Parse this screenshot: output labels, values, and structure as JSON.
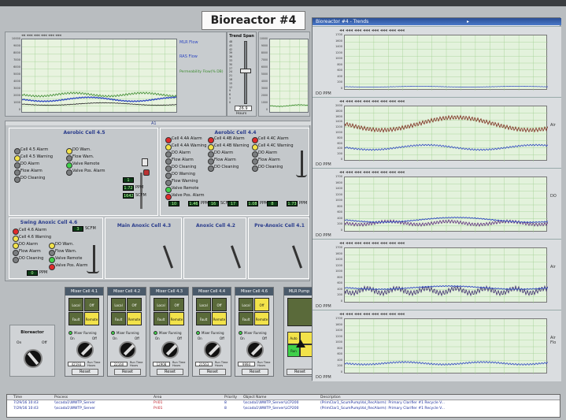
{
  "title": "Bioreactor #4",
  "top_chart": {
    "y_ticks": [
      "10000",
      "9000",
      "8000",
      "7000",
      "6000",
      "5000",
      "4000",
      "3000",
      "2000",
      "1000",
      "0"
    ],
    "legend": [
      {
        "label": "MLR Flow",
        "color": "#2e47c2"
      },
      {
        "label": "RAS Flow",
        "color": "#2e47c2"
      },
      {
        "label": "Permeability Flow(% DB)",
        "color": "#3a8a2c"
      }
    ]
  },
  "trend_span": {
    "label": "Trend Span",
    "ticks": [
      "48",
      "45",
      "42",
      "39",
      "36",
      "33",
      "30",
      "27",
      "24",
      "21",
      "18",
      "15",
      "12",
      "9",
      "6",
      "3",
      "0"
    ],
    "value": "26.9",
    "unit": "Hours"
  },
  "trends_window": {
    "title": "Bioreactor #4 - Trends",
    "rows": [
      {
        "y_ticks": [
          "1700",
          "1600",
          "1400",
          "1200",
          "1000",
          "800",
          "600",
          "400",
          "200",
          "0"
        ],
        "footer": "DO PPM",
        "side": ""
      },
      {
        "y_ticks": [
          "2000",
          "1800",
          "1600",
          "1400",
          "1200",
          "1000",
          "800",
          "600",
          "400",
          "200",
          "0"
        ],
        "footer": "DO PPM",
        "side": "Air"
      },
      {
        "y_ticks": [
          "1700",
          "1600",
          "1400",
          "1200",
          "1000",
          "800",
          "600",
          "400",
          "200",
          "0"
        ],
        "footer": "DO PPM",
        "side": "DO"
      },
      {
        "y_ticks": [
          "1700",
          "1600",
          "1400",
          "1200",
          "1000",
          "800",
          "600",
          "400",
          "200",
          "0"
        ],
        "footer": "DO PPM",
        "side": "Air"
      },
      {
        "y_ticks": [
          "1700",
          "1600",
          "1400",
          "1200",
          "1000",
          "800",
          "600",
          "400",
          "200",
          "0"
        ],
        "footer": "DO PPM",
        "side": "Air Flo"
      }
    ]
  },
  "cell45": {
    "label": "Aerobic Cell 4.5",
    "alarms": [
      {
        "text": "Cell 4.5 Alarm",
        "color": "#7b7e80"
      },
      {
        "text": "Cell 4.5 Warning",
        "color": "#f2e24a"
      },
      {
        "text": "DO Alarm",
        "color": "#7b7e80"
      },
      {
        "text": "Flow Alarm",
        "color": "#7b7e80"
      },
      {
        "text": "DO Cleaning",
        "color": "#7b7e80"
      },
      {
        "text": "DO Warn.",
        "color": "#f2e24a"
      },
      {
        "text": "Flow Warn.",
        "color": "#7b7e80"
      },
      {
        "text": "Valve Remote",
        "color": "#3fd04a"
      },
      {
        "text": "Valve Pos. Alarm",
        "color": "#7b7e80"
      }
    ],
    "values": [
      {
        "v": "1",
        "u": ""
      },
      {
        "v": "1.72",
        "u": "PPM"
      },
      {
        "v": "1642",
        "u": "SCFM"
      }
    ]
  },
  "cell44": {
    "label": "Aerobic Cell 4.4",
    "alarms": [
      {
        "text": "Cell 4.4A Alarm",
        "color": "#e02a2a"
      },
      {
        "text": "Cell 4.4A Warning",
        "color": "#f2e24a"
      },
      {
        "text": "DO Alarm",
        "color": "#7b7e80"
      },
      {
        "text": "Flow Alarm",
        "color": "#7b7e80"
      },
      {
        "text": "DO Cleaning",
        "color": "#7b7e80"
      },
      {
        "text": "DO Warning",
        "color": "#7b7e80"
      },
      {
        "text": "Flow Warning",
        "color": "#7b7e80"
      },
      {
        "text": "Valve Remote",
        "color": "#3fd04a"
      },
      {
        "text": "Valve Pos. Alarm",
        "color": "#e02a2a"
      },
      {
        "text": "Cell 4.4B Alarm",
        "color": "#e02a2a"
      },
      {
        "text": "Cell 4.4B Warning",
        "color": "#f2e24a"
      },
      {
        "text": "DO Alarm",
        "color": "#7b7e80"
      },
      {
        "text": "Flow Alarm",
        "color": "#7b7e80"
      },
      {
        "text": "DO Cleaning",
        "color": "#7b7e80"
      },
      {
        "text": "Cell 4.4C Alarm",
        "color": "#e02a2a"
      },
      {
        "text": "Cell 4.4C Warning",
        "color": "#f2e24a"
      },
      {
        "text": "DO Alarm",
        "color": "#7b7e80"
      },
      {
        "text": "Flow Alarm",
        "color": "#7b7e80"
      },
      {
        "text": "DO Cleaning",
        "color": "#7b7e80"
      }
    ],
    "values": [
      {
        "v": "10",
        "u": ""
      },
      {
        "v": "1.46",
        "u": "PPM"
      },
      {
        "v": "16",
        "u": "SCFM"
      },
      {
        "v": "17",
        "u": ""
      },
      {
        "v": "1.08",
        "u": "PPM"
      },
      {
        "v": "8",
        "u": ""
      },
      {
        "v": "1.73",
        "u": "PPM"
      }
    ]
  },
  "swing": {
    "label": "Swing Anoxic Cell 4.6",
    "alarms": [
      {
        "text": "Cell 4.6 Alarm",
        "color": "#e02a2a"
      },
      {
        "text": "Cell 4.6 Warning",
        "color": "#f2e24a"
      },
      {
        "text": "DO Alarm",
        "color": "#f2e24a"
      },
      {
        "text": "Flow Alarm",
        "color": "#7b7e80"
      },
      {
        "text": "DO Cleaning",
        "color": "#7b7e80"
      },
      {
        "text": "DO Warn.",
        "color": "#f2e24a"
      },
      {
        "text": "Flow Warn.",
        "color": "#7b7e80"
      },
      {
        "text": "Valve Remote",
        "color": "#3fd04a"
      },
      {
        "text": "Valve Pos. Alarm",
        "color": "#e02a2a"
      }
    ],
    "values": [
      {
        "v": "3",
        "u": "SCFM"
      },
      {
        "v": "0",
        "u": "PPM"
      }
    ]
  },
  "lower_cells": [
    {
      "label": "Main Anoxic Cell 4.3"
    },
    {
      "label": "Anoxic Cell 4.2"
    },
    {
      "label": "Pre-Anoxic Cell 4.1"
    }
  ],
  "bioreactor_switch": {
    "label": "Bioreactor",
    "on": "On",
    "off": "Off"
  },
  "mixers": [
    {
      "title": "Mixer Cell 4.1",
      "counter": "42193",
      "rt": "Run Time Hours",
      "reset": "Reset"
    },
    {
      "title": "Mixer Cell 4.2",
      "counter": "22160",
      "rt": "Run Time Hours",
      "reset": "Reset"
    },
    {
      "title": "Mixer Cell 4.3",
      "counter": "12908",
      "rt": "Run Time Hours",
      "reset": "Reset"
    },
    {
      "title": "Mixer Cell 4.4",
      "counter": "21563",
      "rt": "Run Time Hours",
      "reset": "Reset"
    },
    {
      "title": "Mixer Cell 4.6",
      "counter": "9994",
      "rt": "Run Time Hours",
      "reset": "Reset"
    }
  ],
  "mixer_labels": {
    "local": "Local",
    "off": "Off",
    "fault": "Fault",
    "remote": "Remote",
    "running": "Mixer Running",
    "on": "On"
  },
  "mlr_pump": {
    "title": "MLR Pump",
    "reset": "Reset",
    "auto": "Auto",
    "run": "Run"
  },
  "alarm_table": {
    "headers": [
      "Time",
      "Process",
      "Area",
      "Priority",
      "Object Name",
      "Description"
    ],
    "rows": [
      [
        "7/29/16 10:43",
        "\\\\scada1\\WWTP_Server",
        "Pri01",
        "8",
        "\\\\scada1\\WWTP_Server\\LCP200",
        "(PrimClar1_ScumPumpVal_RecAlarm): Primary Clarifier #1  Recycle V..."
      ],
      [
        "7/29/16 10:43",
        "\\\\scada1\\WWTP_Server",
        "Pri01",
        "8",
        "\\\\scada1\\WWTP_Server\\LCP200",
        "(PrimClar1_ScumPumpVal_RecAlarm): Primary Clarifier #1  Recycle V..."
      ]
    ]
  }
}
